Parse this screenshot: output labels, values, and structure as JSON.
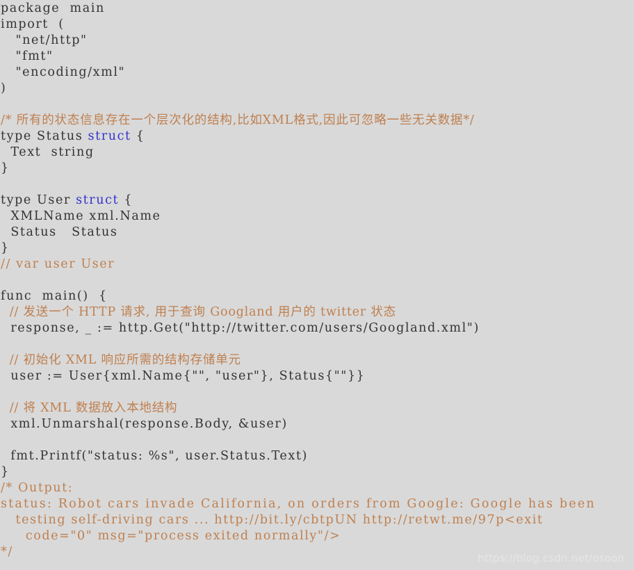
{
  "page": {
    "kind": "latex-code-listing",
    "language": "Go",
    "background_color": "#D9D9D9",
    "code_color": "#333333",
    "comment_color": "#BF8050",
    "keyword_color": "#3333CC",
    "watermark_color": "#E6E6E6"
  },
  "watermark": {
    "text": "https://blog.csdn.net/osoon"
  },
  "code": {
    "lines": [
      {
        "id": "l01",
        "segments": [
          {
            "t": "package  main",
            "c": "plain",
            "sp": "wide"
          }
        ]
      },
      {
        "id": "l02",
        "segments": [
          {
            "t": "import  (",
            "c": "plain",
            "sp": "wide"
          }
        ]
      },
      {
        "id": "l03",
        "segments": [
          {
            "t": "   \"net/http\"",
            "c": "plain",
            "sp": "wide"
          }
        ]
      },
      {
        "id": "l04",
        "segments": [
          {
            "t": "   \"fmt\"",
            "c": "plain",
            "sp": "wide"
          }
        ]
      },
      {
        "id": "l05",
        "segments": [
          {
            "t": "   \"encoding/xml\"",
            "c": "plain",
            "sp": "wide"
          }
        ]
      },
      {
        "id": "l06",
        "segments": [
          {
            "t": ")",
            "c": "plain",
            "sp": "wide"
          }
        ]
      },
      {
        "id": "l07",
        "segments": []
      },
      {
        "id": "l08",
        "segments": [
          {
            "t": "/* 所有的状态信息存在一个层次化的结构,比如XML格式,因此可忽略一些无关数据*/",
            "c": "comment",
            "sp": "cjk"
          }
        ]
      },
      {
        "id": "l09",
        "segments": [
          {
            "t": "type Status ",
            "c": "plain",
            "sp": "wide"
          },
          {
            "t": "struct",
            "c": "keyword",
            "sp": "wide"
          },
          {
            "t": " {",
            "c": "plain",
            "sp": "wide"
          }
        ]
      },
      {
        "id": "l10",
        "segments": [
          {
            "t": "  Text  string",
            "c": "plain",
            "sp": "wide"
          }
        ]
      },
      {
        "id": "l11",
        "segments": [
          {
            "t": "}",
            "c": "plain",
            "sp": "wide"
          }
        ]
      },
      {
        "id": "l12",
        "segments": []
      },
      {
        "id": "l13",
        "segments": [
          {
            "t": "type User ",
            "c": "plain",
            "sp": "wide"
          },
          {
            "t": "struct",
            "c": "keyword",
            "sp": "wide"
          },
          {
            "t": " {",
            "c": "plain",
            "sp": "wide"
          }
        ]
      },
      {
        "id": "l14",
        "segments": [
          {
            "t": "  XMLName xml.Name",
            "c": "plain",
            "sp": "wide"
          }
        ]
      },
      {
        "id": "l15",
        "segments": [
          {
            "t": "  Status   Status",
            "c": "plain",
            "sp": "wide"
          }
        ]
      },
      {
        "id": "l16",
        "segments": [
          {
            "t": "}",
            "c": "plain",
            "sp": "wide"
          }
        ]
      },
      {
        "id": "l17",
        "segments": [
          {
            "t": "// var user User",
            "c": "comment",
            "sp": "wide"
          }
        ]
      },
      {
        "id": "l18",
        "segments": []
      },
      {
        "id": "l19",
        "segments": [
          {
            "t": "func  main()  {",
            "c": "plain",
            "sp": "wide"
          }
        ]
      },
      {
        "id": "l20",
        "segments": [
          {
            "t": "  // 发送一个 HTTP 请求, 用于查询 Googland 用户的 twitter 状态",
            "c": "comment",
            "sp": "cjk"
          }
        ]
      },
      {
        "id": "l21",
        "segments": [
          {
            "t": "  response, _ := http.Get(\"http://twitter.com/users/Googland.xml\")",
            "c": "plain",
            "sp": "wide"
          }
        ]
      },
      {
        "id": "l22",
        "segments": []
      },
      {
        "id": "l23",
        "segments": [
          {
            "t": "  // 初始化 XML 响应所需的结构存储单元",
            "c": "comment",
            "sp": "cjk"
          }
        ]
      },
      {
        "id": "l24",
        "segments": [
          {
            "t": "  user := User{xml.Name{\"\", \"user\"}, Status{\"\"}}",
            "c": "plain",
            "sp": "wide"
          }
        ]
      },
      {
        "id": "l25",
        "segments": []
      },
      {
        "id": "l26",
        "segments": [
          {
            "t": "  // 将 XML 数据放入本地结构",
            "c": "comment",
            "sp": "cjk"
          }
        ]
      },
      {
        "id": "l27",
        "segments": [
          {
            "t": "  xml.Unmarshal(response.Body, &user)",
            "c": "plain",
            "sp": "wide"
          }
        ]
      },
      {
        "id": "l28",
        "segments": []
      },
      {
        "id": "l29",
        "segments": [
          {
            "t": "  fmt.Printf(\"status: %s\", user.Status.Text)",
            "c": "plain",
            "sp": "wide"
          }
        ]
      },
      {
        "id": "l30",
        "segments": [
          {
            "t": "}",
            "c": "plain",
            "sp": "wide"
          }
        ]
      },
      {
        "id": "l31",
        "segments": [
          {
            "t": "/* Output:",
            "c": "comment",
            "sp": "wide"
          }
        ]
      },
      {
        "id": "l32",
        "segments": [
          {
            "t": "status: Robot cars invade California, on orders from Google: Google has been",
            "c": "comment",
            "sp": "wider"
          }
        ]
      },
      {
        "id": "l33",
        "segments": [
          {
            "t": "   testing self-driving cars ... http://bit.ly/cbtpUN http://retwt.me/97p<exit",
            "c": "comment",
            "sp": "wide"
          }
        ]
      },
      {
        "id": "l34",
        "segments": [
          {
            "t": "     code=\"0\" msg=\"process exited normally\"/>",
            "c": "comment",
            "sp": "wide"
          }
        ]
      },
      {
        "id": "l35",
        "segments": [
          {
            "t": "*/",
            "c": "comment",
            "sp": "wide"
          }
        ]
      }
    ]
  }
}
